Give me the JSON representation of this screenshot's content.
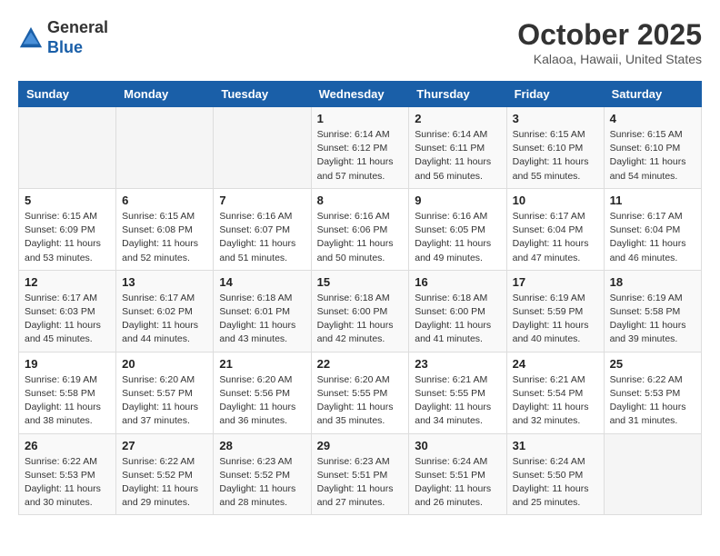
{
  "header": {
    "logo_general": "General",
    "logo_blue": "Blue",
    "month_title": "October 2025",
    "location": "Kalaoa, Hawaii, United States"
  },
  "weekdays": [
    "Sunday",
    "Monday",
    "Tuesday",
    "Wednesday",
    "Thursday",
    "Friday",
    "Saturday"
  ],
  "weeks": [
    [
      {
        "day": "",
        "sunrise": "",
        "sunset": "",
        "daylight": ""
      },
      {
        "day": "",
        "sunrise": "",
        "sunset": "",
        "daylight": ""
      },
      {
        "day": "",
        "sunrise": "",
        "sunset": "",
        "daylight": ""
      },
      {
        "day": "1",
        "sunrise": "Sunrise: 6:14 AM",
        "sunset": "Sunset: 6:12 PM",
        "daylight": "Daylight: 11 hours and 57 minutes."
      },
      {
        "day": "2",
        "sunrise": "Sunrise: 6:14 AM",
        "sunset": "Sunset: 6:11 PM",
        "daylight": "Daylight: 11 hours and 56 minutes."
      },
      {
        "day": "3",
        "sunrise": "Sunrise: 6:15 AM",
        "sunset": "Sunset: 6:10 PM",
        "daylight": "Daylight: 11 hours and 55 minutes."
      },
      {
        "day": "4",
        "sunrise": "Sunrise: 6:15 AM",
        "sunset": "Sunset: 6:10 PM",
        "daylight": "Daylight: 11 hours and 54 minutes."
      }
    ],
    [
      {
        "day": "5",
        "sunrise": "Sunrise: 6:15 AM",
        "sunset": "Sunset: 6:09 PM",
        "daylight": "Daylight: 11 hours and 53 minutes."
      },
      {
        "day": "6",
        "sunrise": "Sunrise: 6:15 AM",
        "sunset": "Sunset: 6:08 PM",
        "daylight": "Daylight: 11 hours and 52 minutes."
      },
      {
        "day": "7",
        "sunrise": "Sunrise: 6:16 AM",
        "sunset": "Sunset: 6:07 PM",
        "daylight": "Daylight: 11 hours and 51 minutes."
      },
      {
        "day": "8",
        "sunrise": "Sunrise: 6:16 AM",
        "sunset": "Sunset: 6:06 PM",
        "daylight": "Daylight: 11 hours and 50 minutes."
      },
      {
        "day": "9",
        "sunrise": "Sunrise: 6:16 AM",
        "sunset": "Sunset: 6:05 PM",
        "daylight": "Daylight: 11 hours and 49 minutes."
      },
      {
        "day": "10",
        "sunrise": "Sunrise: 6:17 AM",
        "sunset": "Sunset: 6:04 PM",
        "daylight": "Daylight: 11 hours and 47 minutes."
      },
      {
        "day": "11",
        "sunrise": "Sunrise: 6:17 AM",
        "sunset": "Sunset: 6:04 PM",
        "daylight": "Daylight: 11 hours and 46 minutes."
      }
    ],
    [
      {
        "day": "12",
        "sunrise": "Sunrise: 6:17 AM",
        "sunset": "Sunset: 6:03 PM",
        "daylight": "Daylight: 11 hours and 45 minutes."
      },
      {
        "day": "13",
        "sunrise": "Sunrise: 6:17 AM",
        "sunset": "Sunset: 6:02 PM",
        "daylight": "Daylight: 11 hours and 44 minutes."
      },
      {
        "day": "14",
        "sunrise": "Sunrise: 6:18 AM",
        "sunset": "Sunset: 6:01 PM",
        "daylight": "Daylight: 11 hours and 43 minutes."
      },
      {
        "day": "15",
        "sunrise": "Sunrise: 6:18 AM",
        "sunset": "Sunset: 6:00 PM",
        "daylight": "Daylight: 11 hours and 42 minutes."
      },
      {
        "day": "16",
        "sunrise": "Sunrise: 6:18 AM",
        "sunset": "Sunset: 6:00 PM",
        "daylight": "Daylight: 11 hours and 41 minutes."
      },
      {
        "day": "17",
        "sunrise": "Sunrise: 6:19 AM",
        "sunset": "Sunset: 5:59 PM",
        "daylight": "Daylight: 11 hours and 40 minutes."
      },
      {
        "day": "18",
        "sunrise": "Sunrise: 6:19 AM",
        "sunset": "Sunset: 5:58 PM",
        "daylight": "Daylight: 11 hours and 39 minutes."
      }
    ],
    [
      {
        "day": "19",
        "sunrise": "Sunrise: 6:19 AM",
        "sunset": "Sunset: 5:58 PM",
        "daylight": "Daylight: 11 hours and 38 minutes."
      },
      {
        "day": "20",
        "sunrise": "Sunrise: 6:20 AM",
        "sunset": "Sunset: 5:57 PM",
        "daylight": "Daylight: 11 hours and 37 minutes."
      },
      {
        "day": "21",
        "sunrise": "Sunrise: 6:20 AM",
        "sunset": "Sunset: 5:56 PM",
        "daylight": "Daylight: 11 hours and 36 minutes."
      },
      {
        "day": "22",
        "sunrise": "Sunrise: 6:20 AM",
        "sunset": "Sunset: 5:55 PM",
        "daylight": "Daylight: 11 hours and 35 minutes."
      },
      {
        "day": "23",
        "sunrise": "Sunrise: 6:21 AM",
        "sunset": "Sunset: 5:55 PM",
        "daylight": "Daylight: 11 hours and 34 minutes."
      },
      {
        "day": "24",
        "sunrise": "Sunrise: 6:21 AM",
        "sunset": "Sunset: 5:54 PM",
        "daylight": "Daylight: 11 hours and 32 minutes."
      },
      {
        "day": "25",
        "sunrise": "Sunrise: 6:22 AM",
        "sunset": "Sunset: 5:53 PM",
        "daylight": "Daylight: 11 hours and 31 minutes."
      }
    ],
    [
      {
        "day": "26",
        "sunrise": "Sunrise: 6:22 AM",
        "sunset": "Sunset: 5:53 PM",
        "daylight": "Daylight: 11 hours and 30 minutes."
      },
      {
        "day": "27",
        "sunrise": "Sunrise: 6:22 AM",
        "sunset": "Sunset: 5:52 PM",
        "daylight": "Daylight: 11 hours and 29 minutes."
      },
      {
        "day": "28",
        "sunrise": "Sunrise: 6:23 AM",
        "sunset": "Sunset: 5:52 PM",
        "daylight": "Daylight: 11 hours and 28 minutes."
      },
      {
        "day": "29",
        "sunrise": "Sunrise: 6:23 AM",
        "sunset": "Sunset: 5:51 PM",
        "daylight": "Daylight: 11 hours and 27 minutes."
      },
      {
        "day": "30",
        "sunrise": "Sunrise: 6:24 AM",
        "sunset": "Sunset: 5:51 PM",
        "daylight": "Daylight: 11 hours and 26 minutes."
      },
      {
        "day": "31",
        "sunrise": "Sunrise: 6:24 AM",
        "sunset": "Sunset: 5:50 PM",
        "daylight": "Daylight: 11 hours and 25 minutes."
      },
      {
        "day": "",
        "sunrise": "",
        "sunset": "",
        "daylight": ""
      }
    ]
  ]
}
